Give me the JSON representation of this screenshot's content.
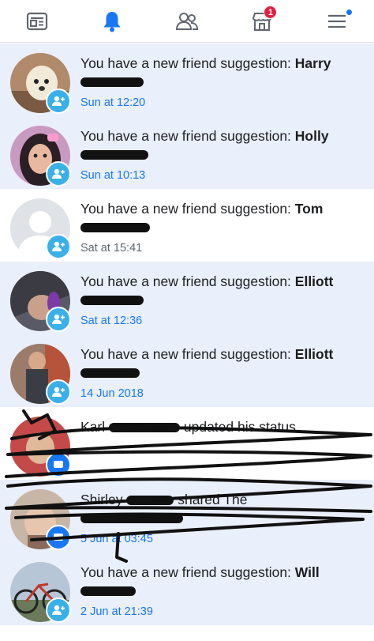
{
  "nav": {
    "tabs": [
      {
        "id": "news-feed",
        "icon": "news-feed-icon",
        "active": false
      },
      {
        "id": "notifications",
        "icon": "bell-icon",
        "active": true
      },
      {
        "id": "friends",
        "icon": "friends-icon",
        "active": false
      },
      {
        "id": "marketplace",
        "icon": "marketplace-icon",
        "active": false,
        "badge": "1"
      },
      {
        "id": "menu",
        "icon": "menu-icon",
        "active": false,
        "dot": true
      }
    ],
    "marketplace_badge": "1"
  },
  "notifications": [
    {
      "prefix": "You have a new friend suggestion: ",
      "name": "Harry",
      "time": "Sun at 12:20",
      "unread": true,
      "type": "friend-suggestion"
    },
    {
      "prefix": "You have a new friend suggestion: ",
      "name": "Holly",
      "time": "Sun at 10:13",
      "unread": true,
      "type": "friend-suggestion"
    },
    {
      "prefix": "You have a new friend suggestion: ",
      "name": "Tom",
      "time": "Sat at 15:41",
      "unread": false,
      "type": "friend-suggestion"
    },
    {
      "prefix": "You have a new friend suggestion: ",
      "name": "Elliott",
      "time": "Sat at 12:36",
      "unread": true,
      "type": "friend-suggestion"
    },
    {
      "prefix": "You have a new friend suggestion: ",
      "name": "Elliott",
      "time": "14 Jun 2018",
      "unread": true,
      "type": "friend-suggestion"
    },
    {
      "prefix": "Karl",
      "name": "updated his status.",
      "time": "",
      "unread": false,
      "type": "status"
    },
    {
      "prefix": "Shirley",
      "name": "shared The",
      "time": "5 Jun at 03:45",
      "unread": true,
      "type": "status"
    },
    {
      "prefix": "You have a new friend suggestion: ",
      "name": "Will",
      "time": "2 Jun at 21:39",
      "unread": true,
      "type": "friend-suggestion"
    }
  ],
  "colors": {
    "accent": "#1877f2",
    "unread_bg": "#e9effb",
    "badge": "#3ab0e8",
    "alert": "#e41e3f"
  }
}
